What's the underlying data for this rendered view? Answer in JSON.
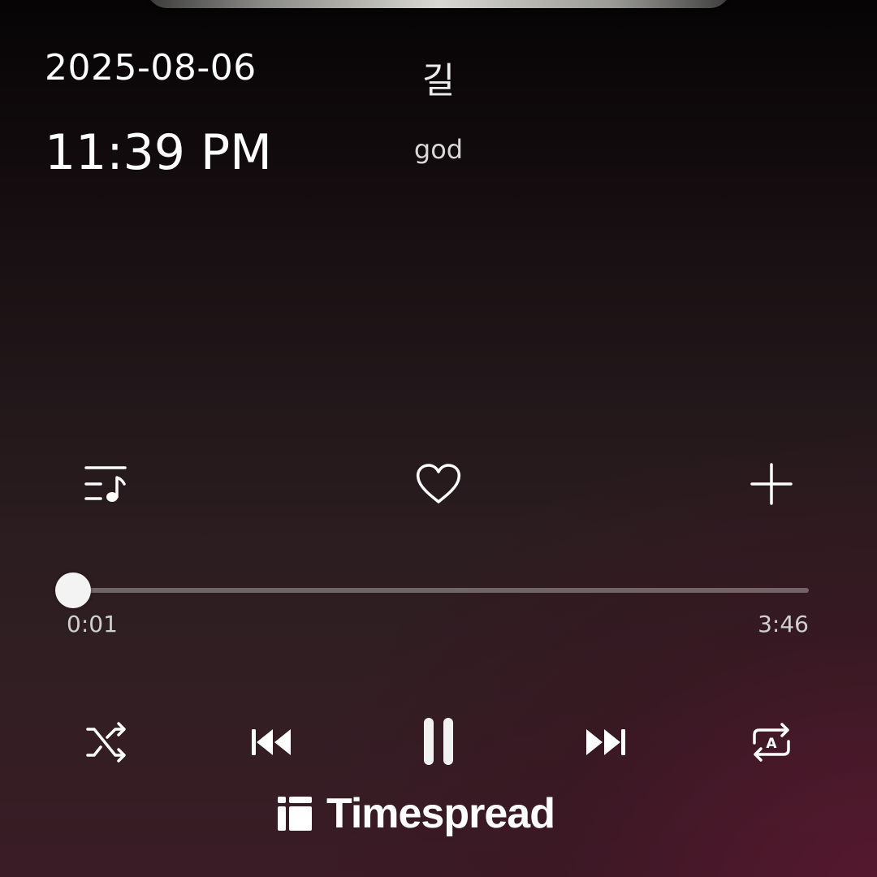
{
  "clock": {
    "date": "2025-08-06",
    "time": "11:39 PM"
  },
  "now_playing": {
    "title": "길",
    "artist": "god"
  },
  "actions": {
    "playlist_icon": "playlist-music-icon",
    "like_icon": "heart-outline-icon",
    "add_icon": "plus-icon"
  },
  "progress": {
    "elapsed": "0:01",
    "total": "3:46",
    "fraction": 0.004
  },
  "controls": {
    "shuffle_icon": "shuffle-icon",
    "previous_icon": "skip-previous-icon",
    "play_state": "playing",
    "pause_icon": "pause-icon",
    "next_icon": "skip-next-icon",
    "repeat_icon": "repeat-auto-icon",
    "repeat_badge": "A"
  },
  "brand": {
    "name": "Timespread"
  },
  "colors": {
    "background_top": "#060405",
    "background_bottom": "#3a1c26",
    "foreground": "#ffffff",
    "track_inactive": "rgba(255,255,255,0.32)"
  }
}
